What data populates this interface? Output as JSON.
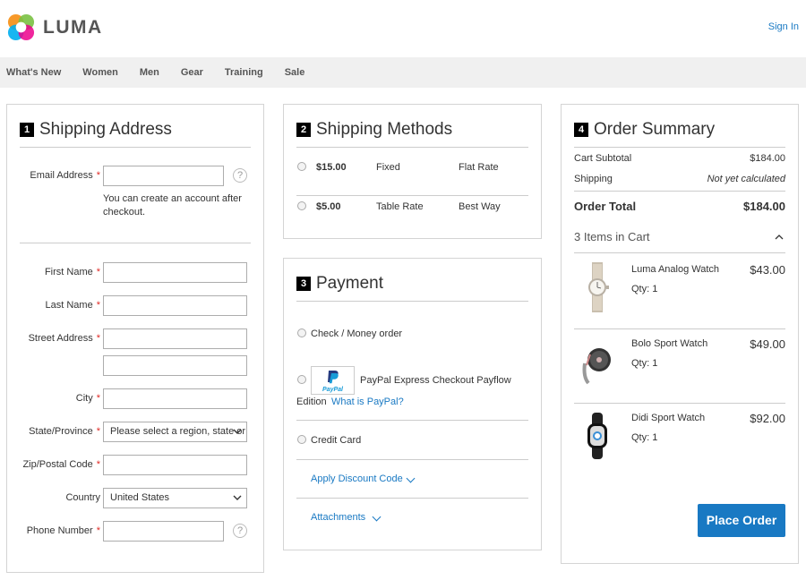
{
  "header": {
    "brand": "LUMA",
    "sign_in": "Sign In"
  },
  "nav": [
    "What's New",
    "Women",
    "Men",
    "Gear",
    "Training",
    "Sale"
  ],
  "shipping_address": {
    "step": "1",
    "title": "Shipping Address",
    "email_label": "Email Address",
    "email_value": "",
    "email_note": "You can create an account after checkout.",
    "first_name_label": "First Name",
    "last_name_label": "Last Name",
    "street_label": "Street Address",
    "city_label": "City",
    "state_label": "State/Province",
    "state_value": "Please select a region, state or province.",
    "zip_label": "Zip/Postal Code",
    "country_label": "Country",
    "country_value": "United States",
    "phone_label": "Phone Number",
    "required_mark": "*",
    "help_glyph": "?"
  },
  "shipping_methods": {
    "step": "2",
    "title": "Shipping Methods",
    "rows": [
      {
        "price": "$15.00",
        "method": "Fixed",
        "carrier": "Flat Rate"
      },
      {
        "price": "$5.00",
        "method": "Table Rate",
        "carrier": "Best Way"
      }
    ]
  },
  "payment": {
    "step": "3",
    "title": "Payment",
    "check_label": "Check / Money order",
    "paypal_label_1": "PayPal Express Checkout Payflow",
    "paypal_label_2": "Edition",
    "paypal_link": "What is PayPal?",
    "credit_card_label": "Credit Card",
    "discount_label": "Apply Discount Code",
    "attachments_label": "Attachments"
  },
  "order_summary": {
    "step": "4",
    "title": "Order Summary",
    "subtotal_label": "Cart Subtotal",
    "subtotal_value": "$184.00",
    "shipping_label": "Shipping",
    "shipping_value": "Not yet calculated",
    "total_label": "Order Total",
    "total_value": "$184.00",
    "items_in_cart": "3 Items in Cart",
    "items": [
      {
        "name": "Luma Analog Watch",
        "qty": "Qty: 1",
        "price": "$43.00"
      },
      {
        "name": "Bolo Sport Watch",
        "qty": "Qty: 1",
        "price": "$49.00"
      },
      {
        "name": "Didi Sport Watch",
        "qty": "Qty: 1",
        "price": "$92.00"
      }
    ],
    "place_order": "Place Order"
  },
  "colors": {
    "accent": "#1979c3",
    "required": "#e02b27",
    "nav_bg": "#f0f0f0"
  }
}
